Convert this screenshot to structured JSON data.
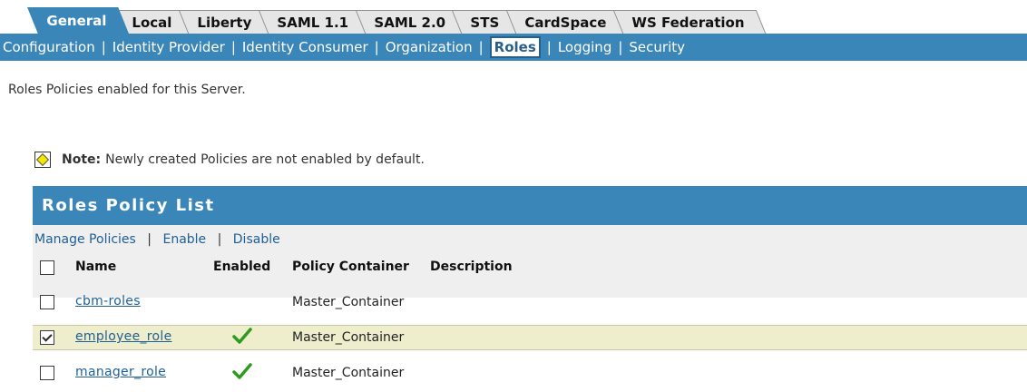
{
  "tabs": [
    {
      "label": "General",
      "active": true
    },
    {
      "label": "Local",
      "active": false
    },
    {
      "label": "Liberty",
      "active": false
    },
    {
      "label": "SAML 1.1",
      "active": false
    },
    {
      "label": "SAML 2.0",
      "active": false
    },
    {
      "label": "STS",
      "active": false
    },
    {
      "label": "CardSpace",
      "active": false
    },
    {
      "label": "WS Federation",
      "active": false
    }
  ],
  "subnav": {
    "items": [
      "Configuration",
      "Identity Provider",
      "Identity Consumer",
      "Organization",
      "Roles",
      "Logging",
      "Security"
    ],
    "separator": "|",
    "current": "Roles"
  },
  "intro_text": "Roles Policies enabled for this Server.",
  "note": {
    "icon": "note-diamond-icon",
    "label": "Note:",
    "text": "Newly created Policies are not enabled by default."
  },
  "panel": {
    "title": "Roles Policy List",
    "actions": {
      "manage": "Manage Policies",
      "enable": "Enable",
      "disable": "Disable",
      "separator": "|"
    },
    "columns": {
      "name": "Name",
      "enabled": "Enabled",
      "container": "Policy Container",
      "description": "Description"
    },
    "rows": [
      {
        "name": "cbm-roles",
        "checked": false,
        "enabled": false,
        "container": "Master_Container",
        "description": ""
      },
      {
        "name": "employee_role",
        "checked": true,
        "enabled": true,
        "container": "Master_Container",
        "description": ""
      },
      {
        "name": "manager_role",
        "checked": false,
        "enabled": true,
        "container": "Master_Container",
        "description": ""
      }
    ]
  },
  "colors": {
    "accent": "#3a86b8",
    "link": "#1e5f96",
    "selected_row": "#efeecc",
    "toolbar_bg": "#efefef",
    "check_green": "#2e9b1f"
  }
}
